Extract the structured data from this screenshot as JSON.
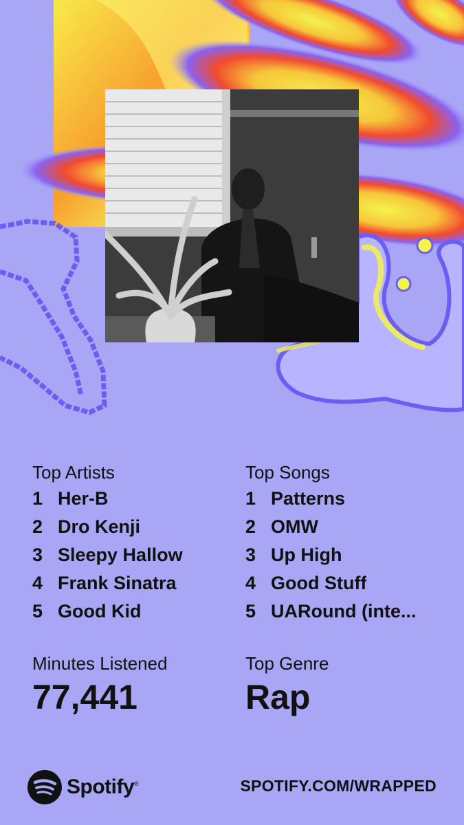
{
  "colors": {
    "background": "#a9a6f6",
    "text": "#111111",
    "accent_yellow": "#f3f34d",
    "accent_red": "#f24a2e",
    "accent_blue": "#6b5ef0"
  },
  "top_artists": {
    "heading": "Top Artists",
    "items": [
      {
        "rank": "1",
        "name": "Her-B"
      },
      {
        "rank": "2",
        "name": "Dro Kenji"
      },
      {
        "rank": "3",
        "name": "Sleepy Hallow"
      },
      {
        "rank": "4",
        "name": "Frank Sinatra"
      },
      {
        "rank": "5",
        "name": "Good Kid"
      }
    ]
  },
  "top_songs": {
    "heading": "Top Songs",
    "items": [
      {
        "rank": "1",
        "name": "Patterns"
      },
      {
        "rank": "2",
        "name": "OMW"
      },
      {
        "rank": "3",
        "name": "Up High"
      },
      {
        "rank": "4",
        "name": "Good Stuff"
      },
      {
        "rank": "5",
        "name": "UARound (inte..."
      }
    ]
  },
  "minutes": {
    "label": "Minutes Listened",
    "value": "77,441"
  },
  "genre": {
    "label": "Top Genre",
    "value": "Rap"
  },
  "footer": {
    "brand": "Spotify",
    "trademark": "®",
    "url": "SPOTIFY.COM/WRAPPED",
    "logo_icon": "spotify-logo-icon"
  },
  "photo": {
    "description_icon": "artist-photo"
  }
}
